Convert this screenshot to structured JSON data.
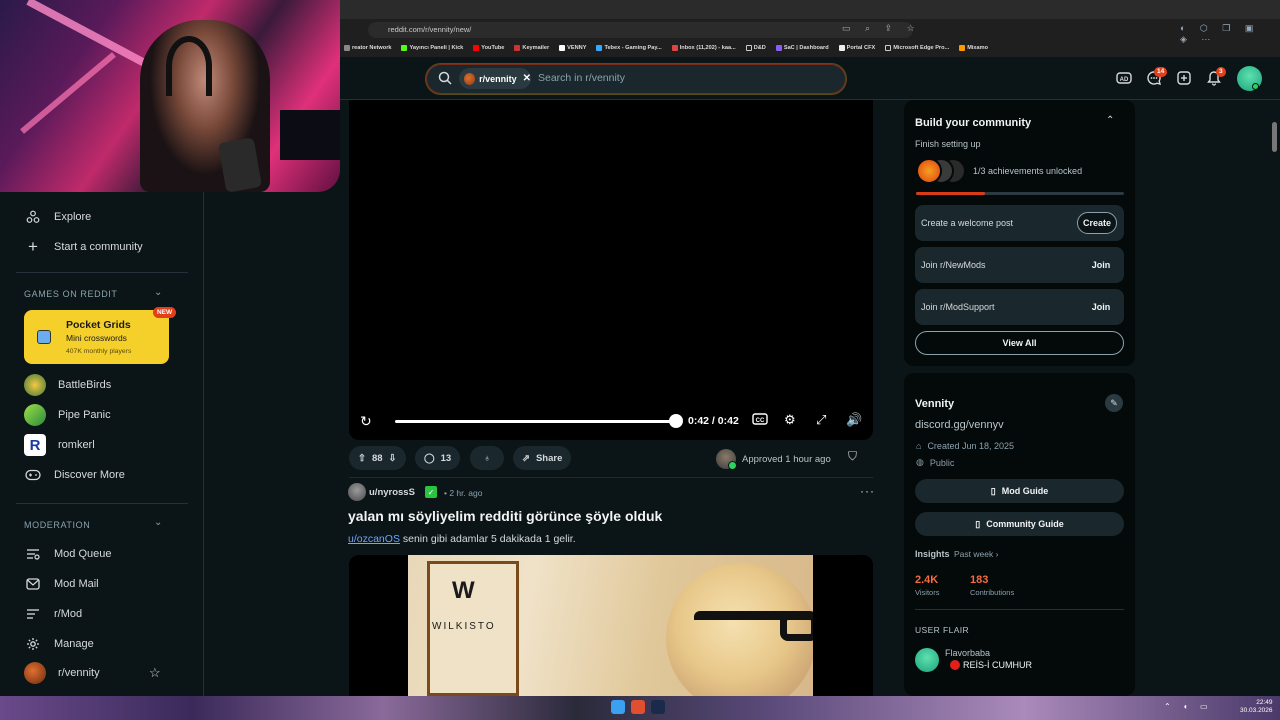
{
  "browser": {
    "url": "reddit.com/r/vennity/new/",
    "bookmarks": [
      "reator Network",
      "Yayıncı Paneli | Kick",
      "YouTube",
      "Keymailer",
      "VENNY",
      "Tebex - Gaming Pay...",
      "Inbox (11,202) - kaa...",
      "D&D",
      "SaC | Dashboard",
      "Portal CFX",
      "Microsoft Edge Pro...",
      "Mixamo"
    ]
  },
  "header": {
    "community_chip": "r/vennity",
    "search_placeholder": "Search in r/vennity",
    "chat_badge": "14",
    "notif_badge": "3"
  },
  "left_nav": {
    "explore": "Explore",
    "start_community": "Start a community",
    "games_section": "GAMES ON REDDIT",
    "game_card": {
      "title": "Pocket Grids",
      "subtitle": "Mini crosswords",
      "players": "407K monthly players",
      "badge": "NEW"
    },
    "games": [
      "BattleBirds",
      "Pipe Panic",
      "romkerl",
      "Discover More"
    ],
    "moderation_section": "MODERATION",
    "mod_items": [
      "Mod Queue",
      "Mod Mail",
      "r/Mod",
      "Manage",
      "r/vennity"
    ]
  },
  "video": {
    "time": "0:42 / 0:42",
    "progress": 1.0
  },
  "post1_actions": {
    "votes": "88",
    "comments": "13",
    "share": "Share",
    "approved": "Approved 1 hour ago"
  },
  "post2": {
    "user": "u/nyrossS",
    "time": "• 2 hr. ago",
    "title": "yalan mı söyliyelim redditi görünce şöyle olduk",
    "body_link": "u/ozcanOS",
    "body_text": " senin gibi adamlar 5 dakikada 1 gelir.",
    "thumb_text": "WILKISTO"
  },
  "build": {
    "title": "Build your community",
    "subtitle": "Finish setting up",
    "achievements": "1/3 achievements unlocked",
    "progress": 0.33,
    "tasks": [
      {
        "label": "Create a welcome post",
        "button": "Create"
      },
      {
        "label": "Join r/NewMods",
        "button": "Join"
      },
      {
        "label": "Join r/ModSupport",
        "button": "Join"
      }
    ],
    "view_all": "View All"
  },
  "community": {
    "name": "Vennity",
    "description": "discord.gg/vennyv",
    "created": "Created Jun 18, 2025",
    "visibility": "Public",
    "mod_guide": "Mod Guide",
    "community_guide": "Community Guide",
    "insights": "Insights",
    "insights_period": "Past week ›",
    "visitors_value": "2.4K",
    "visitors_label": "Visitors",
    "contributions_value": "183",
    "contributions_label": "Contributions"
  },
  "user_flair": {
    "title": "USER FLAIR",
    "username": "Flavorbaba",
    "flair": "REİS-İ CUMHUR"
  },
  "taskbar": {
    "time": "22:49",
    "date": "30.03.2026"
  }
}
